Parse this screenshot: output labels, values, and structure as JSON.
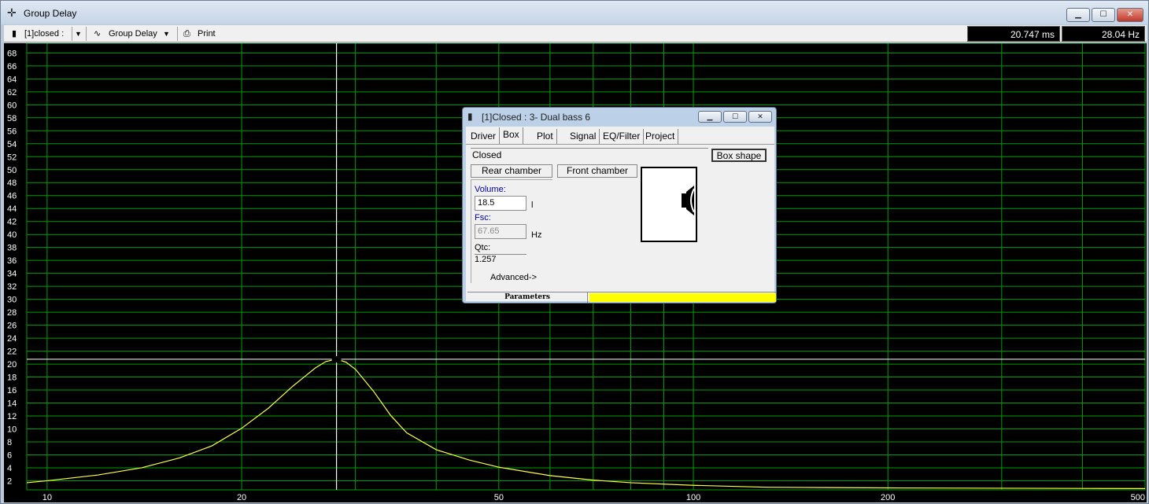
{
  "window": {
    "title": "Group Delay",
    "title_icon": "crosshair-icon",
    "controls": {
      "minimize": "▁",
      "maximize": "☐",
      "close": "✕"
    }
  },
  "toolbar": {
    "item_selector": "[1]closed :",
    "plot_selector": "Group Delay",
    "print_label": "Print",
    "readout_time": "20.747 ms",
    "readout_freq": "28.04 Hz"
  },
  "chart_data": {
    "type": "line",
    "title": "",
    "xlabel": "",
    "ylabel": "",
    "x_scale": "log",
    "xlim": [
      9.3,
      500
    ],
    "ylim": [
      0.6,
      69.5
    ],
    "x_tick_labels": [
      "10",
      "20",
      "50",
      "100",
      "200",
      "500"
    ],
    "x_ticks": [
      10,
      20,
      50,
      100,
      200,
      500
    ],
    "y_ticks": [
      2,
      4,
      6,
      8,
      10,
      12,
      14,
      16,
      18,
      20,
      22,
      24,
      26,
      28,
      30,
      32,
      34,
      36,
      38,
      40,
      42,
      44,
      46,
      48,
      50,
      52,
      54,
      56,
      58,
      60,
      62,
      64,
      66,
      68
    ],
    "y_tick_labels": [
      "2",
      "4",
      "6",
      "8",
      "10",
      "12",
      "14",
      "16",
      "18",
      "20",
      "22",
      "24",
      "26",
      "28",
      "30",
      "32",
      "34",
      "36",
      "38",
      "40",
      "42",
      "44",
      "46",
      "48",
      "50",
      "52",
      "54",
      "56",
      "58",
      "60",
      "62",
      "64",
      "66",
      "68"
    ],
    "grid": true,
    "background": "#000000",
    "grid_color": "#00a000",
    "cursor": {
      "x": 28.04,
      "y": 20.747,
      "color": "#ffffff"
    },
    "series": [
      {
        "color": "#ffff40",
        "x": [
          9.3,
          10,
          12,
          14,
          16,
          18,
          20,
          22,
          24,
          26,
          27,
          28.04,
          29,
          30,
          32,
          34,
          36,
          40,
          45,
          50,
          60,
          70,
          80,
          100,
          130,
          160,
          200,
          300,
          400,
          500
        ],
        "y": [
          1.7,
          2.0,
          2.9,
          4.0,
          5.5,
          7.4,
          10.1,
          13.2,
          16.6,
          19.4,
          20.4,
          20.75,
          20.3,
          19.2,
          15.8,
          12.1,
          9.4,
          6.8,
          5.2,
          4.1,
          2.8,
          2.1,
          1.7,
          1.3,
          1.0,
          0.95,
          0.9,
          0.85,
          0.82,
          0.8
        ]
      }
    ]
  },
  "dialog": {
    "title": "[1]Closed : 3- Dual bass 6",
    "tabs": [
      "Driver",
      "Box",
      "Plot",
      "Signal",
      "EQ/Filter",
      "Project"
    ],
    "active_tab": "Box",
    "box_type": "Closed",
    "box_shape_button": "Box shape",
    "rear_chamber": "Rear chamber",
    "front_chamber": "Front chamber",
    "volume_label": "Volume:",
    "volume_value": "18.5",
    "volume_unit": "l",
    "fsc_label": "Fsc:",
    "fsc_value": "67.65",
    "fsc_unit": "Hz",
    "qtc_label": "Qtc:",
    "qtc_value": "1.257",
    "advanced": "Advanced->",
    "status_label": "Parameters",
    "status_color": "#ffff00"
  }
}
